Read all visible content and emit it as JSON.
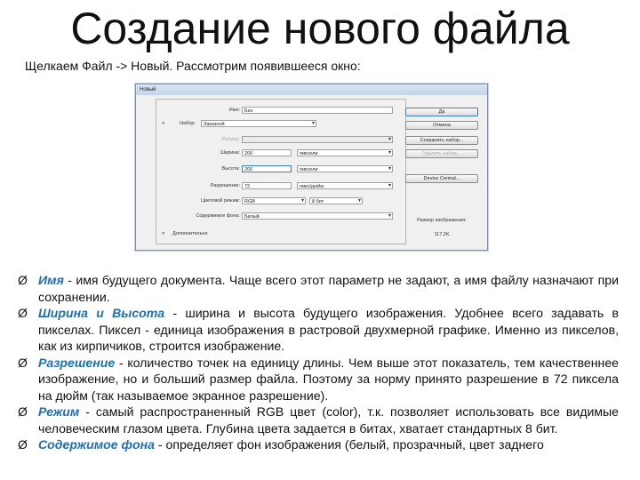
{
  "title": "Создание нового файла",
  "subtitle": "Щелкаем Файл -> Новый. Рассмотрим появившееся окно:",
  "dialog": {
    "window_title": "Новый",
    "name_label": "Имя:",
    "name_value": "Без",
    "preset_label": "Набор:",
    "preset_value": "Заказной",
    "size_label": "Размер:",
    "width_label": "Ширина:",
    "width_value": "200",
    "width_unit": "пиксели",
    "height_label": "Высота:",
    "height_value": "200",
    "height_unit": "пиксели",
    "resolution_label": "Разрешение:",
    "resolution_value": "72",
    "resolution_unit": "пикс/дюйм",
    "color_mode_label": "Цветовой режим:",
    "color_mode_value": "RGB",
    "bit_depth_value": "8 бит",
    "background_label": "Содержимое фона:",
    "background_value": "Белый",
    "advanced_label": "Дополнительно",
    "buttons": {
      "ok": "Да",
      "cancel": "Отмена",
      "save_preset": "Сохранить набор...",
      "delete_preset": "Удалить набор...",
      "device_central": "Device Central..."
    },
    "image_size_label": "Размер изображения:",
    "image_size_value": "117,2K"
  },
  "bullets": [
    {
      "term": "Имя",
      "text": " - имя будущего документа. Чаще всего этот параметр не задают, а имя файлу назначают при сохранении."
    },
    {
      "term": "Ширина и Высота",
      "text": " - ширина и высота будущего изображения. Удобнее всего задавать в пикселах. Пиксел - единица изображения в растровой двухмерной графике. Именно из пикселов, как из кирпичиков, строится изображение."
    },
    {
      "term": "Разрешение",
      "text": " - количество точек на единицу длины. Чем выше этот показатель, тем качественнее изображение, но и больший размер файла. Поэтому за норму принято разрешение в 72 пиксела на дюйм (так называемое экранное разрешение)."
    },
    {
      "term": "Режим",
      "text": " - самый распространенный RGB цвет (color), т.к. позволяет использовать все видимые человеческим глазом цвета. Глубина цвета задается в битах, хватает стандартных 8 бит."
    },
    {
      "term": "Содержимое фона",
      "text": " - определяет фон изображения (белый, прозрачный, цвет заднего"
    }
  ],
  "bullet_marker": "Ø"
}
